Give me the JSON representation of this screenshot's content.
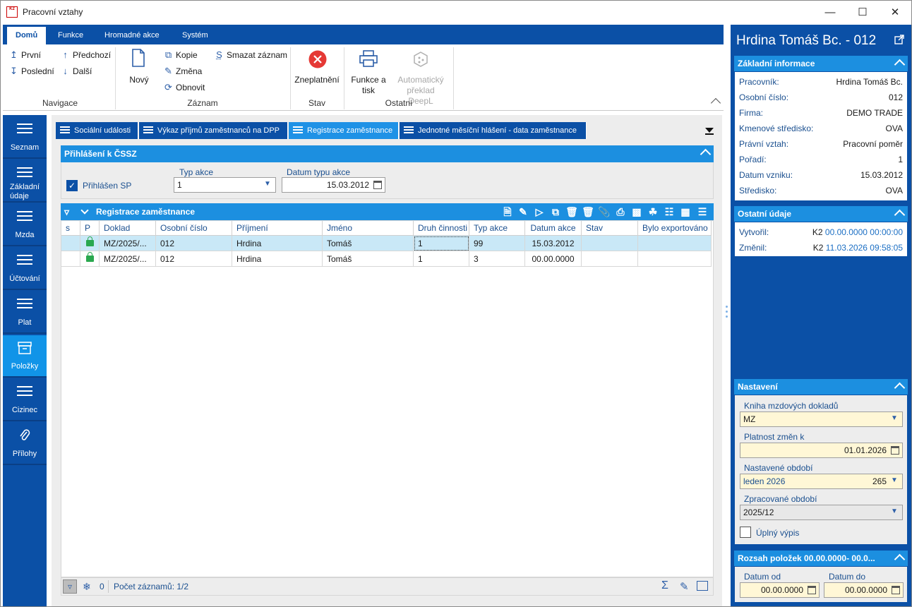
{
  "window": {
    "title": "Pracovní vztahy",
    "app_icon_text": "K2"
  },
  "ribbon": {
    "tabs": [
      "Domů",
      "Funkce",
      "Hromadné akce",
      "Systém"
    ],
    "navigation": {
      "first": "První",
      "last": "Poslední",
      "previous": "Předchozí",
      "next": "Další",
      "group_label": "Navigace"
    },
    "record": {
      "new": "Nový",
      "copy": "Kopie",
      "change": "Změna",
      "refresh": "Obnovit",
      "delete": "Smazat záznam",
      "group_label": "Záznam"
    },
    "state": {
      "invalidate": "Zneplatnění",
      "group_label": "Stav"
    },
    "other": {
      "print_line1": "Funkce a",
      "print_line2": "tisk",
      "translate_line1": "Automatický",
      "translate_line2": "překlad DeepL",
      "group_label": "Ostatní"
    }
  },
  "sidebar": {
    "items": [
      {
        "label": "Seznam",
        "active": false
      },
      {
        "label_line1": "Základní",
        "label_line2": "údaje",
        "active": false
      },
      {
        "label": "Mzda",
        "active": false
      },
      {
        "label": "Účtování",
        "active": false
      },
      {
        "label": "Plat",
        "active": false
      },
      {
        "label": "Položky",
        "active": true
      },
      {
        "label": "Cizinec",
        "active": false
      },
      {
        "label": "Přílohy",
        "active": false
      }
    ]
  },
  "doc_tabs": [
    "Sociální události",
    "Výkaz příjmů zaměstnanců na DPP",
    "Registrace zaměstnance",
    "Jednotné měsíční hlášení - data zaměstnance"
  ],
  "prihlaseni": {
    "title": "Přihlášení k ČSSZ",
    "checkbox_label": "Přihlášen SP",
    "checked": true,
    "typ_akce_label": "Typ akce",
    "typ_akce_value": "1",
    "datum_label": "Datum typu akce",
    "datum_value": "15.03.2012"
  },
  "grid": {
    "title": "Registrace zaměstnance",
    "columns": [
      "s",
      "P",
      "Doklad",
      "Osobní číslo",
      "Příjmení",
      "Jméno",
      "Druh činnosti",
      "Typ akce",
      "Datum akce",
      "Stav",
      "Bylo exportováno"
    ],
    "rows": [
      {
        "doklad": "MZ/2025/...",
        "osobni_cislo": "012",
        "prijmeni": "Hrdina",
        "jmeno": "Tomáš",
        "druh": "1",
        "typ": "99",
        "datum": "15.03.2012",
        "stav": "",
        "export": ""
      },
      {
        "doklad": "MZ/2025/...",
        "osobni_cislo": "012",
        "prijmeni": "Hrdina",
        "jmeno": "Tomáš",
        "druh": "1",
        "typ": "3",
        "datum": "00.00.0000",
        "stav": "",
        "export": ""
      }
    ],
    "status": {
      "filter_count": "0",
      "record_count": "Počet záznamů: 1/2"
    }
  },
  "right": {
    "employee_title": "Hrdina Tomáš Bc. - 012",
    "basic": {
      "title": "Základní informace",
      "items": [
        {
          "k": "Pracovník:",
          "v": "Hrdina Tomáš Bc."
        },
        {
          "k": "Osobní číslo:",
          "v": "012"
        },
        {
          "k": "Firma:",
          "v": "DEMO TRADE"
        },
        {
          "k": "Kmenové středisko:",
          "v": "OVA"
        },
        {
          "k": "Právní vztah:",
          "v": "Pracovní poměr"
        },
        {
          "k": "Pořadí:",
          "v": "1"
        },
        {
          "k": "Datum vzniku:",
          "v": "15.03.2012"
        },
        {
          "k": "Středisko:",
          "v": "OVA"
        }
      ]
    },
    "other": {
      "title": "Ostatní údaje",
      "created_label": "Vytvořil:",
      "created_user": "K2",
      "created_time": "00.00.0000 00:00:00",
      "changed_label": "Změnil:",
      "changed_user": "K2",
      "changed_time": "11.03.2026 09:58:05"
    },
    "settings": {
      "title": "Nastavení",
      "book_label": "Kniha mzdových dokladů",
      "book_value": "MZ",
      "validity_label": "Platnost změn k",
      "validity_value": "01.01.2026",
      "period_label": "Nastavené období",
      "period_value": "leden 2026",
      "period_code": "265",
      "processed_label": "Zpracované období",
      "processed_value": "2025/12",
      "full_listing_label": "Úplný výpis"
    },
    "range": {
      "title": "Rozsah položek 00.00.0000- 00.0...",
      "from_label": "Datum od",
      "from_value": "00.00.0000",
      "to_label": "Datum do",
      "to_value": "00.00.0000"
    }
  },
  "colors": {
    "primary": "#0b50a6",
    "accent": "#1c8fe0",
    "selected_row": "#c9e8f7",
    "yellow_field": "#fff7d6"
  }
}
